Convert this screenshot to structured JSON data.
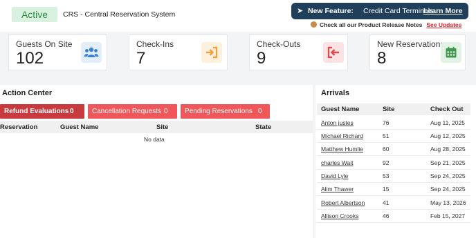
{
  "header": {
    "status": "Active",
    "system_name": "CRS - Central Reservation System"
  },
  "banner": {
    "feature_label": "New Feature:",
    "feature_text": "Credit Card Terminals",
    "learn_more": "Learn More",
    "release_notes_text": "Check all our Product Release Notes",
    "see_updates": "See Updates"
  },
  "stats": [
    {
      "label": "Guests On Site",
      "value": "102",
      "icon": "guests-icon",
      "color": "#3a7fd1"
    },
    {
      "label": "Check-Ins",
      "value": "7",
      "icon": "check-in-icon",
      "color": "#f0a13a"
    },
    {
      "label": "Check-Outs",
      "value": "9",
      "icon": "check-out-icon",
      "color": "#e0474c"
    },
    {
      "label": "New Reservations",
      "value": "8",
      "icon": "calendar-icon",
      "color": "#3e9a4a"
    }
  ],
  "action_center": {
    "title": "Action Center",
    "tabs": [
      {
        "label": "Refund Evaluations",
        "count": "0"
      },
      {
        "label": "Cancellation Requests",
        "count": "0"
      },
      {
        "label": "Pending Reservations",
        "count": "0"
      }
    ],
    "columns": [
      "Reservation",
      "Guest Name",
      "Site",
      "State"
    ],
    "empty_text": "No data"
  },
  "arrivals": {
    "title": "Arrivals",
    "columns": [
      "Guest Name",
      "Site",
      "Check Out"
    ],
    "rows": [
      {
        "guest": "Anton justes",
        "site": "76",
        "checkout": "Aug 11, 2025"
      },
      {
        "guest": "Michael Richard",
        "site": "51",
        "checkout": "Aug 12, 2025"
      },
      {
        "guest": "Matthew Humlie",
        "site": "60",
        "checkout": "Aug 28, 2025"
      },
      {
        "guest": "charles Wait",
        "site": "92",
        "checkout": "Sep 21, 2025"
      },
      {
        "guest": "David Lyle",
        "site": "53",
        "checkout": "Sep 24, 2025"
      },
      {
        "guest": "Alim Thawer",
        "site": "15",
        "checkout": "Sep 24, 2025"
      },
      {
        "guest": "Robert Albertson",
        "site": "41",
        "checkout": "May 13, 2026"
      },
      {
        "guest": "Allison Crooks",
        "site": "46",
        "checkout": "Feb 15, 2027"
      }
    ]
  },
  "colors": {
    "banner_bg": "#1f3f5b",
    "active_tab": "#c93a3f",
    "tab": "#f0575a",
    "status_bg": "#d9f2df",
    "status_text": "#2e8b45"
  }
}
